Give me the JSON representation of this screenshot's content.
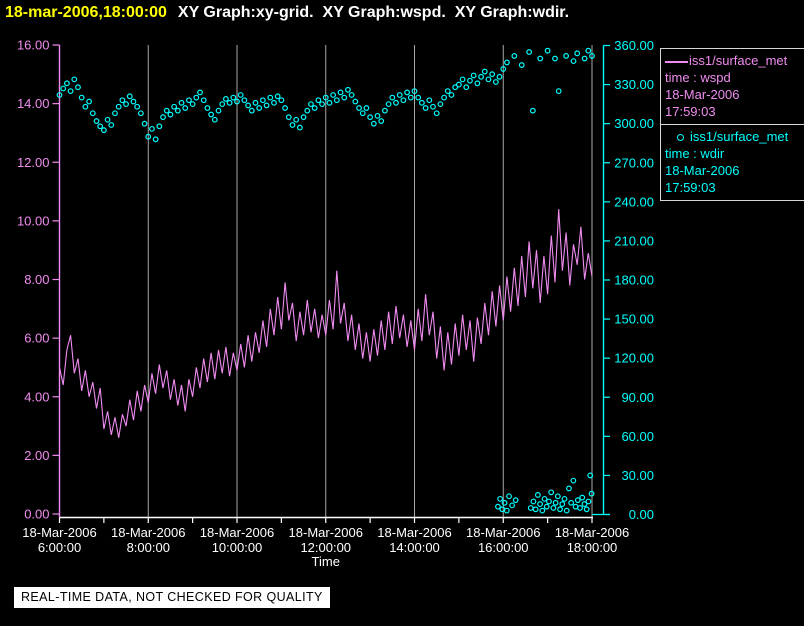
{
  "window": {
    "title_time": "18-mar-2006,18:00:00",
    "title_rest": "XY Graph:xy-grid.  XY Graph:wspd.  XY Graph:wdir."
  },
  "banner": {
    "text": "REAL-TIME DATA, NOT CHECKED FOR QUALITY"
  },
  "legend": {
    "entries": [
      {
        "symbol": "line-sample",
        "source": "iss1/surface_met",
        "variable": "time : wspd",
        "date": "18-Mar-2006",
        "time": "17:59:03",
        "color": "#f08cf0"
      },
      {
        "symbol": "circle-sample",
        "source": "iss1/surface_met",
        "variable": "time : wdir",
        "date": "18-Mar-2006",
        "time": "17:59:03",
        "color": "#00ffff"
      }
    ]
  },
  "colors": {
    "background": "#000000",
    "title_time": "#ffff00",
    "title_rest": "#ffffff",
    "wspd": "#f08cf0",
    "wdir": "#00ffff",
    "grid": "#a8a8a8",
    "x_axis": "#ffffff",
    "banner_bg": "#ffffff",
    "banner_text": "#000000",
    "legend_border": "#d8d8d8"
  },
  "chart_data": {
    "type": "line+scatter",
    "xlabel": "Time",
    "grid": "vertical",
    "x_axis": {
      "start_hour": 6,
      "end_hour": 18,
      "ticks": [
        {
          "hour": 6,
          "date": "18-Mar-2006",
          "time": "6:00:00"
        },
        {
          "hour": 8,
          "date": "18-Mar-2006",
          "time": "8:00:00"
        },
        {
          "hour": 10,
          "date": "18-Mar-2006",
          "time": "10:00:00"
        },
        {
          "hour": 12,
          "date": "18-Mar-2006",
          "time": "12:00:00"
        },
        {
          "hour": 14,
          "date": "18-Mar-2006",
          "time": "14:00:00"
        },
        {
          "hour": 16,
          "date": "18-Mar-2006",
          "time": "16:00:00"
        },
        {
          "hour": 18,
          "date": "18-Mar-2006",
          "time": "18:00:00"
        }
      ],
      "minor_tick_hours": [
        6,
        7,
        8,
        9,
        10,
        11,
        12,
        13,
        14,
        15,
        16,
        17,
        18
      ],
      "gridline_hours": [
        8,
        10,
        12,
        14,
        16,
        18
      ]
    },
    "y_left": {
      "name": "wspd",
      "min": 0,
      "max": 16,
      "color": "#f08cf0",
      "ticks": [
        {
          "value": 16,
          "label": "16.00"
        },
        {
          "value": 14,
          "label": "14.00"
        },
        {
          "value": 12,
          "label": "12.00"
        },
        {
          "value": 10,
          "label": "10.00"
        },
        {
          "value": 8,
          "label": "8.00"
        },
        {
          "value": 6,
          "label": "6.00"
        },
        {
          "value": 4,
          "label": "4.00"
        },
        {
          "value": 2,
          "label": "2.00"
        },
        {
          "value": 0,
          "label": "0.00"
        }
      ]
    },
    "y_right": {
      "name": "wdir",
      "min": 0,
      "max": 360,
      "color": "#00ffff",
      "ticks": [
        {
          "value": 360,
          "label": "360.00"
        },
        {
          "value": 330,
          "label": "330.00"
        },
        {
          "value": 300,
          "label": "300.00"
        },
        {
          "value": 270,
          "label": "270.00"
        },
        {
          "value": 240,
          "label": "240.00"
        },
        {
          "value": 210,
          "label": "210.00"
        },
        {
          "value": 180,
          "label": "180.00"
        },
        {
          "value": 150,
          "label": "150.00"
        },
        {
          "value": 120,
          "label": "120.00"
        },
        {
          "value": 90,
          "label": "90.00"
        },
        {
          "value": 60,
          "label": "60.00"
        },
        {
          "value": 30,
          "label": "30.00"
        },
        {
          "value": 0,
          "label": "0.00"
        }
      ]
    },
    "series": [
      {
        "name": "wspd",
        "type": "line",
        "axis": "left",
        "color": "#f08cf0",
        "t_start_hour": 6,
        "t_step_min": 5,
        "values": [
          5.0,
          4.4,
          5.6,
          6.1,
          4.8,
          5.3,
          4.2,
          4.9,
          4.0,
          4.5,
          3.6,
          4.3,
          2.9,
          3.5,
          2.7,
          3.3,
          2.6,
          3.4,
          3.0,
          3.9,
          3.2,
          4.2,
          3.5,
          4.4,
          3.8,
          4.8,
          4.1,
          5.1,
          4.3,
          4.9,
          3.9,
          4.6,
          3.7,
          4.4,
          3.5,
          4.6,
          4.0,
          5.0,
          4.3,
          5.3,
          4.5,
          5.5,
          4.6,
          5.6,
          4.8,
          5.7,
          4.7,
          5.5,
          4.9,
          5.8,
          5.0,
          6.1,
          5.2,
          6.2,
          5.5,
          6.6,
          5.7,
          7.0,
          6.1,
          7.4,
          6.3,
          7.9,
          6.6,
          7.2,
          5.9,
          6.9,
          6.1,
          7.3,
          6.2,
          7.0,
          6.0,
          6.8,
          6.1,
          7.3,
          6.3,
          8.3,
          6.5,
          7.2,
          5.9,
          6.8,
          5.6,
          6.5,
          5.3,
          6.2,
          5.2,
          6.3,
          5.4,
          6.6,
          5.6,
          6.9,
          5.8,
          7.1,
          6.0,
          6.8,
          5.7,
          6.6,
          5.6,
          7.0,
          5.9,
          7.5,
          6.1,
          6.9,
          5.3,
          6.4,
          4.9,
          6.2,
          5.1,
          6.5,
          5.4,
          6.8,
          5.6,
          6.6,
          5.2,
          6.7,
          5.8,
          7.2,
          6.1,
          7.6,
          6.4,
          7.8,
          6.6,
          8.1,
          6.9,
          8.4,
          7.1,
          8.8,
          7.4,
          9.3,
          7.7,
          9.0,
          7.2,
          8.8,
          7.5,
          9.5,
          7.9,
          10.4,
          8.3,
          9.6,
          7.8,
          9.2,
          8.5,
          9.8,
          8.0,
          8.9,
          8.1
        ]
      },
      {
        "name": "wdir",
        "type": "scatter",
        "axis": "right",
        "color": "#00ffff",
        "t_start_hour": 6,
        "t_step_min": 5,
        "values": [
          322,
          327,
          331,
          325,
          334,
          328,
          320,
          313,
          317,
          308,
          302,
          298,
          295,
          303,
          299,
          308,
          313,
          318,
          315,
          321,
          317,
          313,
          308,
          300,
          290,
          296,
          288,
          298,
          305,
          310,
          307,
          313,
          310,
          316,
          312,
          318,
          315,
          320,
          324,
          318,
          312,
          307,
          303,
          310,
          315,
          319,
          316,
          320,
          317,
          322,
          318,
          314,
          310,
          316,
          312,
          318,
          314,
          320,
          316,
          321,
          318,
          312,
          305,
          299,
          303,
          297,
          305,
          310,
          315,
          312,
          318,
          315,
          320,
          316,
          322,
          318,
          324,
          320,
          326,
          322,
          317,
          312,
          308,
          312,
          305,
          300,
          306,
          302,
          310,
          315,
          320,
          316,
          322,
          318,
          324,
          320,
          325,
          320,
          316,
          312,
          318,
          313,
          308,
          315,
          320,
          325,
          322,
          328,
          330,
          334,
          328,
          333,
          337,
          331,
          336,
          340,
          334,
          338,
          332,
          336,
          342,
          347,
          null,
          352,
          null,
          345,
          null,
          355,
          310,
          null,
          350,
          null,
          356,
          null,
          350,
          325,
          null,
          352,
          null,
          348,
          354,
          null,
          350,
          356,
          352
        ],
        "extra_points": [
          [
            15.88,
            6
          ],
          [
            15.93,
            12
          ],
          [
            15.98,
            4
          ],
          [
            16.03,
            9
          ],
          [
            16.08,
            3
          ],
          [
            16.13,
            14
          ],
          [
            16.2,
            7
          ],
          [
            16.28,
            11
          ],
          [
            16.62,
            5
          ],
          [
            16.68,
            10
          ],
          [
            16.73,
            4
          ],
          [
            16.78,
            15
          ],
          [
            16.83,
            8
          ],
          [
            16.88,
            3
          ],
          [
            16.93,
            12
          ],
          [
            16.98,
            6
          ],
          [
            17.03,
            10
          ],
          [
            17.08,
            17
          ],
          [
            17.13,
            5
          ],
          [
            17.18,
            9
          ],
          [
            17.23,
            14
          ],
          [
            17.28,
            4
          ],
          [
            17.33,
            8
          ],
          [
            17.38,
            12
          ],
          [
            17.43,
            3
          ],
          [
            17.48,
            20
          ],
          [
            17.53,
            9
          ],
          [
            17.58,
            26
          ],
          [
            17.63,
            6
          ],
          [
            17.68,
            11
          ],
          [
            17.73,
            5
          ],
          [
            17.78,
            13
          ],
          [
            17.83,
            8
          ],
          [
            17.88,
            4
          ],
          [
            17.92,
            10
          ],
          [
            17.96,
            30
          ],
          [
            17.99,
            16
          ]
        ]
      }
    ]
  }
}
